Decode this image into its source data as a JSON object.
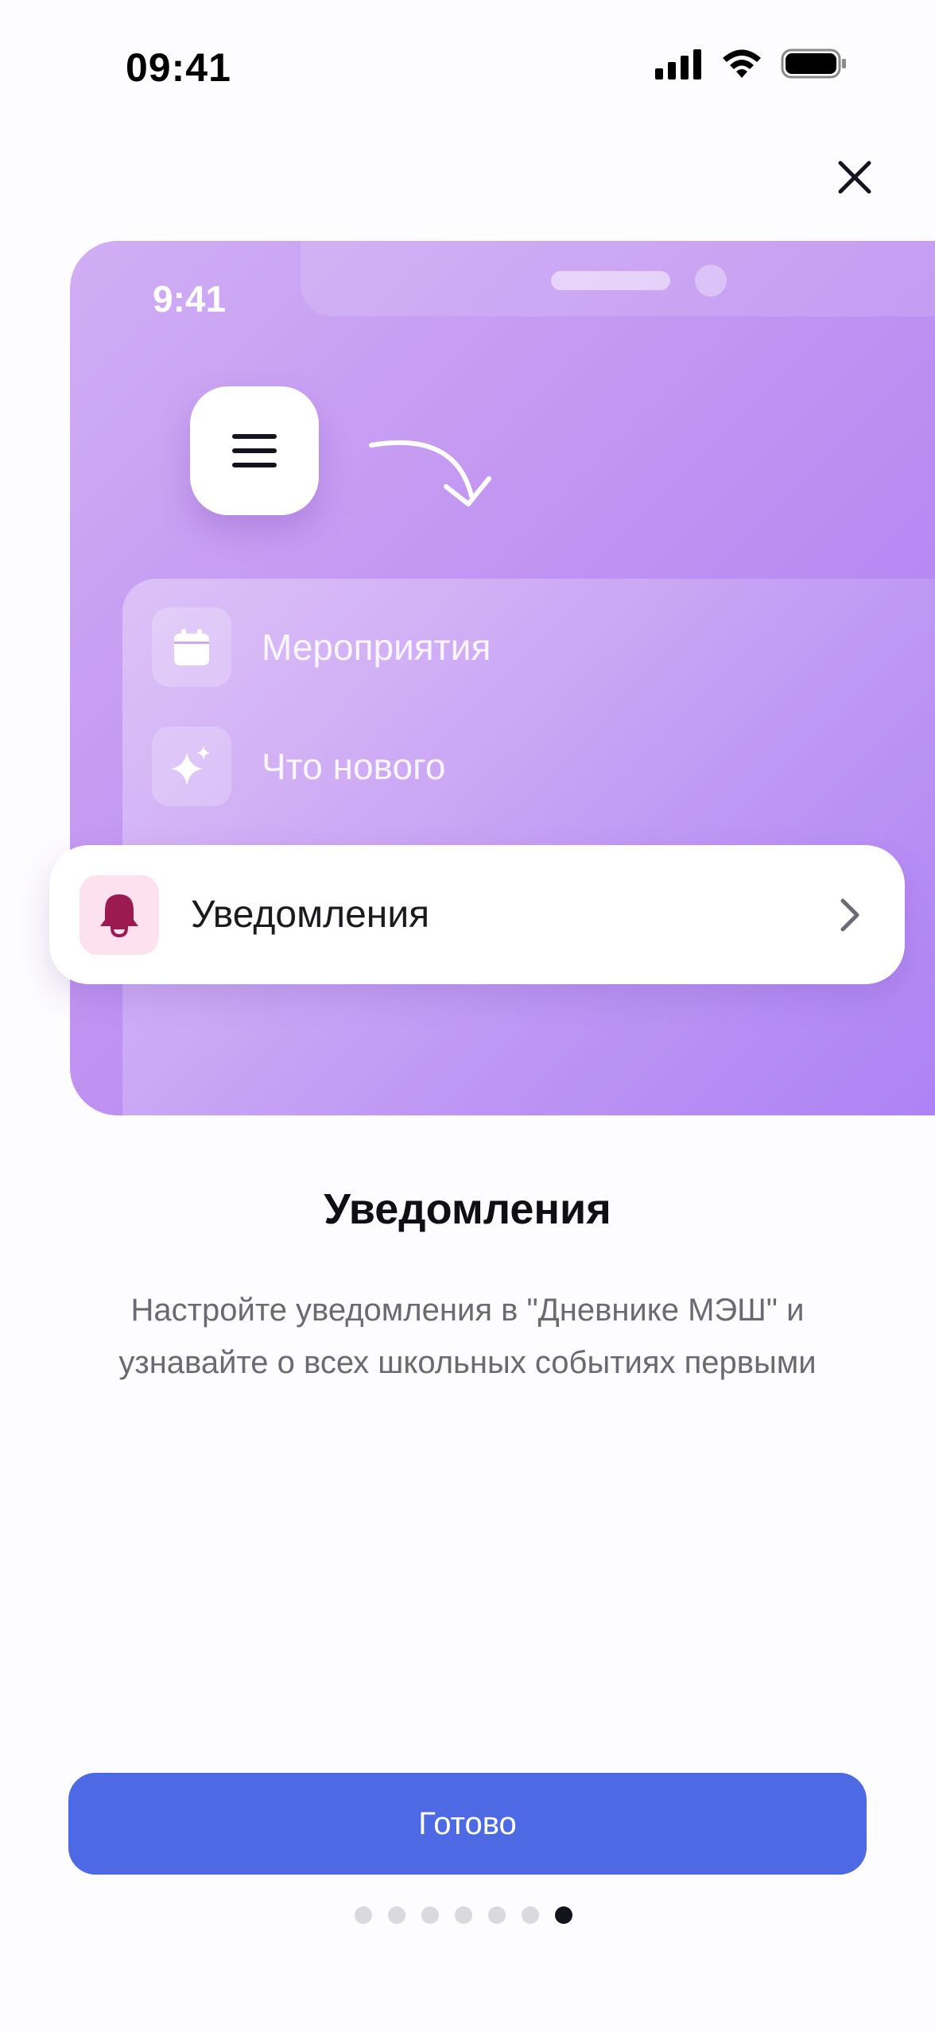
{
  "status_bar": {
    "time": "09:41"
  },
  "illustration": {
    "time": "9:41",
    "menu_items": [
      {
        "label": "Мероприятия",
        "icon": "calendar-icon"
      },
      {
        "label": "Что нового",
        "icon": "sparkles-icon"
      }
    ],
    "highlight_item": {
      "label": "Уведомления",
      "icon": "bell-icon"
    }
  },
  "content": {
    "title": "Уведомления",
    "description": "Настройте уведомления в \"Дневнике МЭШ\" и узнавайте о всех школьных событиях первыми"
  },
  "actions": {
    "done_label": "Готово"
  },
  "pagination": {
    "total": 7,
    "current": 7
  },
  "colors": {
    "accent": "#4d6ae4",
    "illustration_start": "#d1aef4",
    "illustration_end": "#a97af4",
    "bell": "#9b1b50",
    "bell_bg": "#fde1ef"
  }
}
